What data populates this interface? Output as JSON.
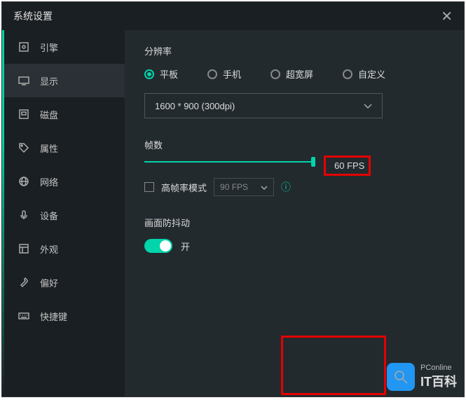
{
  "title": "系统设置",
  "sidebar": {
    "items": [
      {
        "label": "引擎"
      },
      {
        "label": "显示"
      },
      {
        "label": "磁盘"
      },
      {
        "label": "属性"
      },
      {
        "label": "网络"
      },
      {
        "label": "设备"
      },
      {
        "label": "外观"
      },
      {
        "label": "偏好"
      },
      {
        "label": "快捷键"
      }
    ]
  },
  "main": {
    "resolution_label": "分辨率",
    "radios": {
      "tablet": "平板",
      "phone": "手机",
      "ultrawide": "超宽屏",
      "custom": "自定义"
    },
    "resolution_value": "1600 * 900 (300dpi)",
    "fps_label": "帧数",
    "fps_value": "60 FPS",
    "high_fps_checkbox": "高帧率模式",
    "high_fps_select": "90 FPS",
    "anti_shake_label": "画面防抖动",
    "anti_shake_state": "开"
  },
  "watermark": {
    "small": "PConline",
    "main": "IT百科"
  }
}
